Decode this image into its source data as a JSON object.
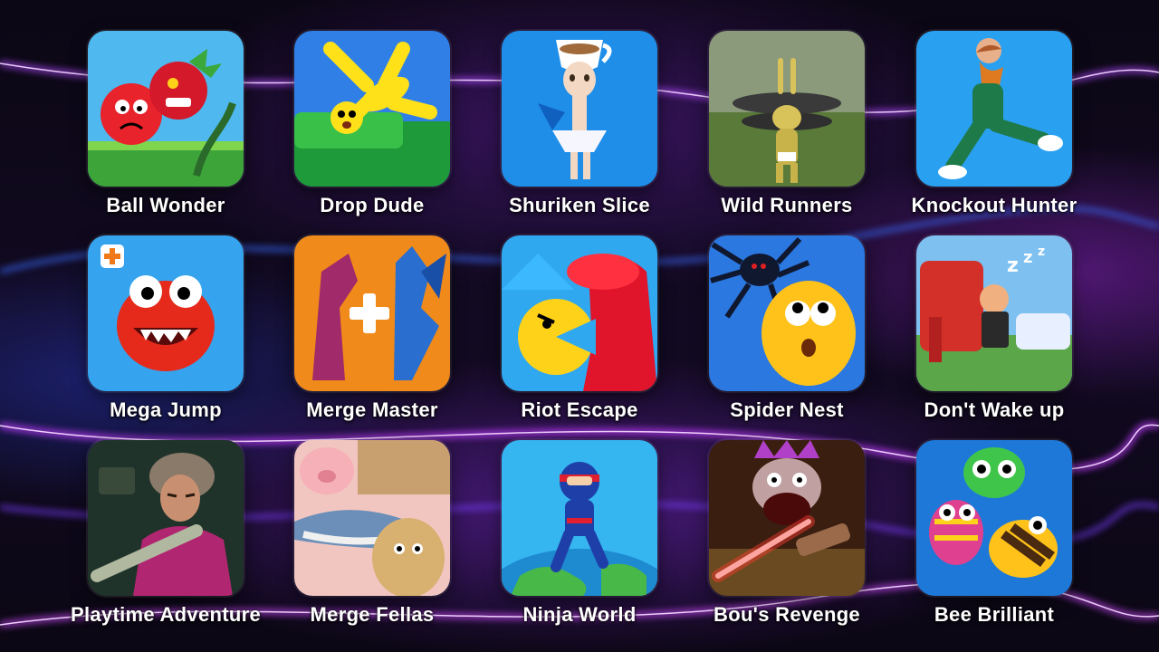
{
  "games": [
    {
      "title": "Ball Wonder",
      "icon": "red-ball-icon",
      "bg": "#4fb8ee",
      "accent": "#e8232b"
    },
    {
      "title": "Drop Dude",
      "icon": "falling-ragdoll-icon",
      "bg": "#2f7fe6",
      "accent": "#ffe11a"
    },
    {
      "title": "Shuriken Slice",
      "icon": "ballerina-teacup-icon",
      "bg": "#1f8ee8",
      "accent": "#f3e2d2"
    },
    {
      "title": "Wild Runners",
      "icon": "rabbit-runner-icon",
      "bg": "#6f8a4a",
      "accent": "#d8c25a"
    },
    {
      "title": "Knockout Hunter",
      "icon": "kicking-man-icon",
      "bg": "#2aa0f0",
      "accent": "#1e7a48"
    },
    {
      "title": "Mega Jump",
      "icon": "red-monster-icon",
      "bg": "#35a3ee",
      "accent": "#e52a1c"
    },
    {
      "title": "Merge Master",
      "icon": "dinosaur-plus-dragon-icon",
      "bg": "#f08a1a",
      "accent": "#2a6fd0"
    },
    {
      "title": "Riot Escape",
      "icon": "angry-pacman-icon",
      "bg": "#2fa8f0",
      "accent": "#ffd21a"
    },
    {
      "title": "Spider Nest",
      "icon": "spider-yellow-face-icon",
      "bg": "#2b78e0",
      "accent": "#ffc21a"
    },
    {
      "title": "Don't Wake up",
      "icon": "sleeping-elephant-icon",
      "bg": "#5aa648",
      "accent": "#d23028"
    },
    {
      "title": "Playtime Adventure",
      "icon": "scary-teacher-icon",
      "bg": "#20332a",
      "accent": "#b02670"
    },
    {
      "title": "Merge Fellas",
      "icon": "pig-shark-fella-icon",
      "bg": "#f2c6c0",
      "accent": "#6b8fb8"
    },
    {
      "title": "Ninja World",
      "icon": "ninja-globe-icon",
      "bg": "#35b6f0",
      "accent": "#1f3fa8"
    },
    {
      "title": "Bou's Revenge",
      "icon": "lightsaber-monster-icon",
      "bg": "#3a1e10",
      "accent": "#ff3a30"
    },
    {
      "title": "Bee Brilliant",
      "icon": "bee-bugs-icon",
      "bg": "#1e78d8",
      "accent": "#3fc64a"
    }
  ]
}
